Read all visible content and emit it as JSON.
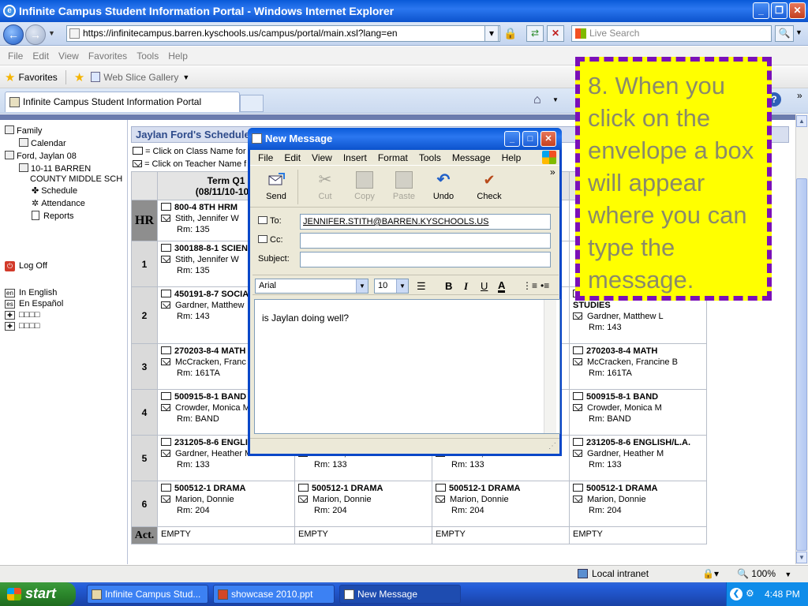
{
  "window": {
    "title": "Infinite Campus Student Information Portal - Windows Internet Explorer"
  },
  "address": {
    "url": "https://infinitecampus.barren.kyschools.us/campus/portal/main.xsl?lang=en",
    "search_placeholder": "Live Search"
  },
  "menubar": [
    "File",
    "Edit",
    "View",
    "Favorites",
    "Tools",
    "Help"
  ],
  "favbar": {
    "favorites_label": "Favorites",
    "webslice_label": "Web Slice Gallery"
  },
  "tab": {
    "title": "Infinite Campus Student Information Portal"
  },
  "sidebar": {
    "family": "Family",
    "calendar": "Calendar",
    "student": "Ford, Jaylan 08",
    "school_line1": "10-11 BARREN",
    "school_line2": "COUNTY MIDDLE SCH",
    "schedule": "Schedule",
    "attendance": "Attendance",
    "reports": "Reports",
    "logoff": "Log Off",
    "lang_en": "In English",
    "lang_es": "En Español",
    "lang_3": "□□□□",
    "lang_4": "□□□□",
    "lang_en_code": "en",
    "lang_es_code": "es"
  },
  "schedule": {
    "title": "Jaylan Ford's Schedule f",
    "legend_class": "= Click on Class Name for",
    "legend_teacher": "= Click on Teacher Name f",
    "terms": [
      {
        "label": "Term Q1",
        "dates": "(08/11/10-10/1"
      },
      {
        "label": "",
        "dates": ""
      },
      {
        "label": "",
        "dates": ""
      },
      {
        "label": "",
        "dates": ""
      }
    ],
    "act_label": "Act.",
    "empty": "EMPTY",
    "rows": [
      {
        "period": "HR",
        "cells": [
          {
            "name": "800-4 8TH HRM",
            "teacher": "Stith, Jennifer W",
            "room": "Rm: 135"
          },
          {
            "name": "",
            "teacher": "",
            "room": ""
          },
          {
            "name": "",
            "teacher": "",
            "room": ""
          },
          {
            "name": "",
            "teacher": "",
            "room": ""
          }
        ]
      },
      {
        "period": "1",
        "cells": [
          {
            "name": "300188-8-1 SCIEN",
            "teacher": "Stith, Jennifer W",
            "room": "Rm: 135"
          },
          {
            "name": "",
            "teacher": "",
            "room": ""
          },
          {
            "name": "",
            "teacher": "",
            "room": ""
          },
          {
            "name": "",
            "teacher": "",
            "room": ""
          }
        ]
      },
      {
        "period": "2",
        "cells": [
          {
            "name": "450191-8-7 SOCIA",
            "teacher": "Gardner, Matthew",
            "room": "Rm: 143"
          },
          {
            "name": "S",
            "teacher": "",
            "room": ""
          },
          {
            "name": "",
            "teacher": "",
            "room": ""
          },
          {
            "name": "450191-8-7 SOCIAL STUDIES",
            "teacher": "Gardner, Matthew L",
            "room": "Rm: 143"
          }
        ]
      },
      {
        "period": "3",
        "cells": [
          {
            "name": "270203-8-4 MATH",
            "teacher": "McCracken, Franc",
            "room": "Rm: 161TA"
          },
          {
            "name": "",
            "teacher": "",
            "room": ""
          },
          {
            "name": "",
            "teacher": "",
            "room": ""
          },
          {
            "name": "270203-8-4 MATH",
            "teacher": "McCracken, Francine B",
            "room": "Rm: 161TA"
          }
        ]
      },
      {
        "period": "4",
        "cells": [
          {
            "name": "500915-8-1 BAND",
            "teacher": "Crowder, Monica M",
            "room": "Rm: BAND"
          },
          {
            "name": "",
            "teacher": "",
            "room": ""
          },
          {
            "name": "",
            "teacher": "",
            "room": ""
          },
          {
            "name": "500915-8-1 BAND",
            "teacher": "Crowder, Monica M",
            "room": "Rm: BAND"
          }
        ]
      },
      {
        "period": "5",
        "cells": [
          {
            "name": "231205-8-6 ENGLI",
            "teacher": "Gardner, Heather M",
            "room": "Rm: 133"
          },
          {
            "name": "",
            "teacher": "Gardner, Heather M",
            "room": "Rm: 133"
          },
          {
            "name": "",
            "teacher": "Gardner, Heather M",
            "room": "Rm: 133"
          },
          {
            "name": "231205-8-6 ENGLISH/L.A.",
            "teacher": "Gardner, Heather M",
            "room": "Rm: 133"
          }
        ]
      },
      {
        "period": "6",
        "cells": [
          {
            "name": "500512-1 DRAMA",
            "teacher": "Marion, Donnie",
            "room": "Rm: 204"
          },
          {
            "name": "500512-1 DRAMA",
            "teacher": "Marion, Donnie",
            "room": "Rm: 204"
          },
          {
            "name": "500512-1 DRAMA",
            "teacher": "Marion, Donnie",
            "room": "Rm: 204"
          },
          {
            "name": "500512-1 DRAMA",
            "teacher": "Marion, Donnie",
            "room": "Rm: 204"
          }
        ]
      }
    ]
  },
  "dialog": {
    "title": "New Message",
    "menu": [
      "File",
      "Edit",
      "View",
      "Insert",
      "Format",
      "Tools",
      "Message",
      "Help"
    ],
    "toolbar": {
      "send": "Send",
      "cut": "Cut",
      "copy": "Copy",
      "paste": "Paste",
      "undo": "Undo",
      "check": "Check"
    },
    "to_label": "To:",
    "to_value": "JENNIFER.STITH@BARREN.KYSCHOOLS.US",
    "cc_label": "Cc:",
    "cc_value": "",
    "subject_label": "Subject:",
    "subject_value": "",
    "font": "Arial",
    "font_size": "10",
    "body": "is Jaylan doing well?"
  },
  "status": {
    "zone": "Local intranet",
    "zoom": "100%"
  },
  "taskbar": {
    "start": "start",
    "tasks": [
      "Infinite Campus Stud...",
      "showcase 2010.ppt",
      "New Message"
    ],
    "clock": "4:48 PM"
  },
  "annotation": {
    "text": "8. When you click on the envelope a box will appear where you can type the message."
  }
}
